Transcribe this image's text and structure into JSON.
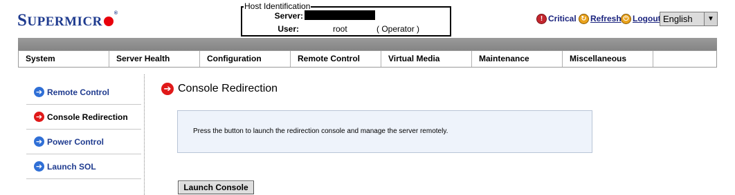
{
  "logo": {
    "first_letter": "S",
    "rest": "UPERMICR",
    "reg": "®"
  },
  "host": {
    "legend": "Host Identification",
    "server_label": "Server:",
    "user_label": "User:",
    "user_value": "root",
    "user_role": "( Operator )"
  },
  "top_links": {
    "critical": "Critical",
    "refresh": "Refresh",
    "logout": "Logout"
  },
  "language": {
    "selected": "English"
  },
  "menu": [
    "System",
    "Server Health",
    "Configuration",
    "Remote Control",
    "Virtual Media",
    "Maintenance",
    "Miscellaneous"
  ],
  "sidebar": [
    {
      "label": "Remote Control",
      "active": false
    },
    {
      "label": "Console Redirection",
      "active": true
    },
    {
      "label": "Power Control",
      "active": false
    },
    {
      "label": "Launch SOL",
      "active": false
    }
  ],
  "page": {
    "title": "Console Redirection",
    "info": "Press the button to launch the redirection console and manage the server remotely.",
    "button": "Launch Console"
  },
  "colors": {
    "brand": "#1f3b8f",
    "active_arrow": "#e01919",
    "nav_arrow": "#2f6fd6"
  }
}
